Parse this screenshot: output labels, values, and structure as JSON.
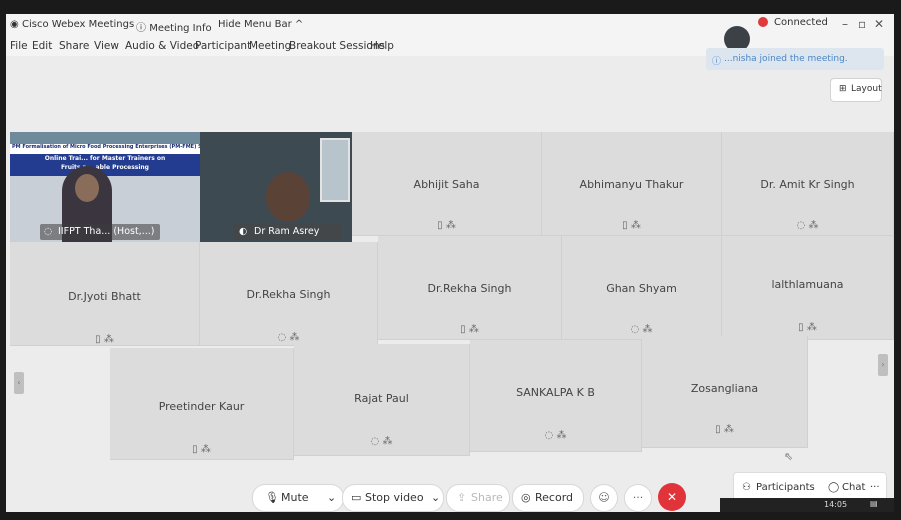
{
  "titlebar": {
    "app_title": "Cisco Webex Meetings",
    "meeting_info": "Meeting Info",
    "hide_menu": "Hide Menu Bar ^",
    "connected": "Connected"
  },
  "menu": [
    "File",
    "Edit",
    "Share",
    "View",
    "Audio & Video",
    "Participant",
    "Meeting",
    "Breakout Sessions",
    "Help"
  ],
  "notification": "...nisha joined the meeting.",
  "layout_label": "Layout",
  "video_tiles": {
    "host": {
      "name": "IIFPT Tha... (Host,...)",
      "slide_header": "PM Formalisation of Micro Food Processing Enterprises (PM-FME) Scheme",
      "slide_line1": "Online Trai... for Master Trainers on",
      "slide_line2": "Fruits a... able Processing"
    },
    "ram": {
      "name": "Dr Ram Asrey"
    }
  },
  "participants": [
    {
      "name": "Abhijit Saha",
      "icons": "▯ ⁂"
    },
    {
      "name": "Abhimanyu Thakur",
      "icons": "▯ ⁂"
    },
    {
      "name": "Dr. Amit Kr Singh",
      "icons": "◌ ⁂"
    },
    {
      "name": "Dr.Jyoti Bhatt",
      "icons": "▯ ⁂"
    },
    {
      "name": "Dr.Rekha Singh",
      "icons": "◌ ⁂"
    },
    {
      "name": "Dr.Rekha Singh",
      "icons": "▯ ⁂"
    },
    {
      "name": "Ghan Shyam",
      "icons": "◌ ⁂"
    },
    {
      "name": "lalthlamuana",
      "icons": "▯ ⁂"
    },
    {
      "name": "Preetinder Kaur",
      "icons": "▯ ⁂"
    },
    {
      "name": "Rajat Paul",
      "icons": "◌ ⁂"
    },
    {
      "name": "SANKALPA K B",
      "icons": "◌ ⁂"
    },
    {
      "name": "Zosangliana",
      "icons": "▯ ⁂"
    }
  ],
  "toolbar": {
    "mute": "Mute",
    "stop_video": "Stop video",
    "share": "Share",
    "record": "Record",
    "participants": "Participants",
    "chat": "Chat"
  },
  "taskbar": {
    "time": "14:05"
  },
  "colors": {
    "end_call": "#e0333a",
    "connected_dot": "#e03a3a",
    "notification_text": "#4a86c5"
  }
}
